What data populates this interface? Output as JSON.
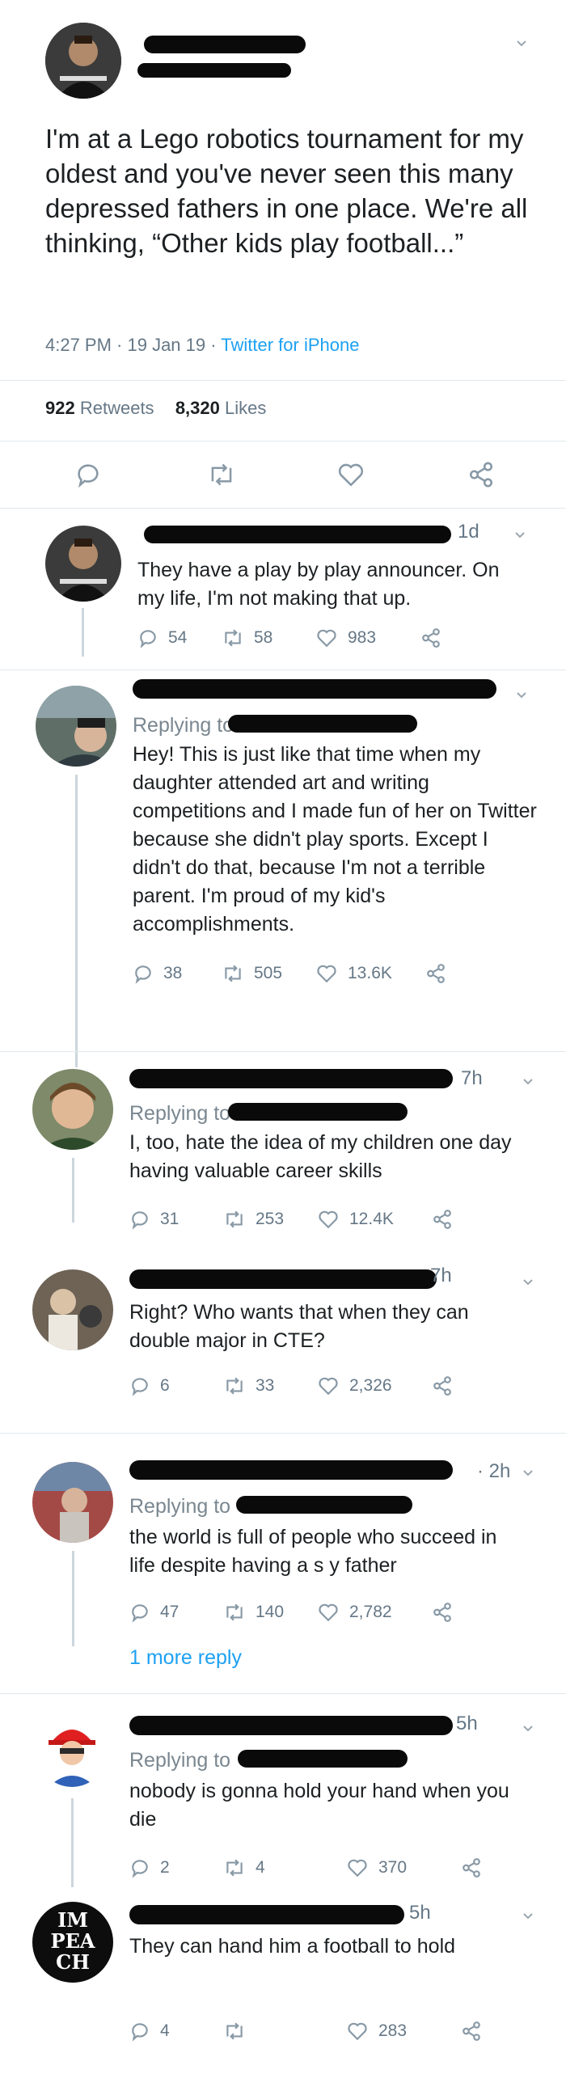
{
  "main_tweet": {
    "text": "I'm at a Lego robotics tournament for my oldest and you've never seen this many depressed fathers in one place. We're all thinking, “Other kids play football...”",
    "timestamp": "4:27 PM · 19 Jan 19 · ",
    "source": "Twitter for iPhone",
    "retweets_count": "922",
    "retweets_label": "Retweets",
    "likes_count": "8,320",
    "likes_label": "Likes"
  },
  "replies": [
    {
      "time": "1d",
      "replying_to": "",
      "text": "They have a play by play announcer. On my life, I'm not making that up.",
      "reply_count": "54",
      "retweet_count": "58",
      "like_count": "983"
    },
    {
      "time": "",
      "replying_to": "Replying to",
      "text": "Hey! This is just like that time when my daughter attended art and writing competitions and I made fun of her on Twitter because she didn't play sports. Except I didn't do that, because I'm not a terrible parent. I'm proud of my kid's accomplishments.",
      "reply_count": "38",
      "retweet_count": "505",
      "like_count": "13.6K"
    },
    {
      "time": "7h",
      "replying_to": "Replying to",
      "text": "I, too, hate the idea of my children one day having valuable career skills",
      "reply_count": "31",
      "retweet_count": "253",
      "like_count": "12.4K"
    },
    {
      "time": "7h",
      "replying_to": "",
      "text": "Right? Who wants that when they can double major in CTE?",
      "reply_count": "6",
      "retweet_count": "33",
      "like_count": "2,326"
    },
    {
      "time": "· 2h",
      "replying_to": "Replying to",
      "text": "the world is full of people who succeed in life despite having a s    y father",
      "reply_count": "47",
      "retweet_count": "140",
      "like_count": "2,782",
      "more_replies": "1 more reply"
    },
    {
      "time": "5h",
      "replying_to": "Replying to",
      "text": "nobody is gonna hold your hand when you die",
      "reply_count": "2",
      "retweet_count": "4",
      "like_count": "370"
    },
    {
      "time": "5h",
      "replying_to": "",
      "text": "They can hand him a football to hold",
      "reply_count": "4",
      "retweet_count": "",
      "like_count": "283",
      "avatar_text": "IM PEA CH"
    }
  ],
  "colors": {
    "link": "#1da1f2",
    "muted": "#657786",
    "text": "#1c2022",
    "divider": "#e1e8ed"
  },
  "icons": [
    "chevron-down-icon",
    "reply-icon",
    "retweet-icon",
    "like-icon",
    "share-icon"
  ]
}
